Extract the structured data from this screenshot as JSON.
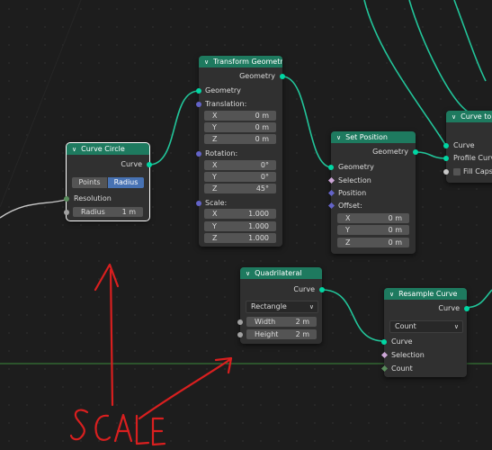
{
  "nodes": {
    "curve_circle": {
      "title": "Curve Circle",
      "output_curve": "Curve",
      "mode_points": "Points",
      "mode_radius": "Radius",
      "resolution": "Resolution",
      "radius_label": "Radius",
      "radius_value": "1 m"
    },
    "transform": {
      "title": "Transform Geometry",
      "output_geometry": "Geometry",
      "input_geometry": "Geometry",
      "translation": "Translation:",
      "tx": "X",
      "tx_val": "0 m",
      "ty": "Y",
      "ty_val": "0 m",
      "tz": "Z",
      "tz_val": "0 m",
      "rotation": "Rotation:",
      "rx": "X",
      "rx_val": "0°",
      "ry": "Y",
      "ry_val": "0°",
      "rz": "Z",
      "rz_val": "45°",
      "scale": "Scale:",
      "sx": "X",
      "sx_val": "1.000",
      "sy": "Y",
      "sy_val": "1.000",
      "sz": "Z",
      "sz_val": "1.000"
    },
    "set_position": {
      "title": "Set Position",
      "output_geometry": "Geometry",
      "input_geometry": "Geometry",
      "selection": "Selection",
      "position": "Position",
      "offset": "Offset:",
      "ox": "X",
      "ox_val": "0 m",
      "oy": "Y",
      "oy_val": "0 m",
      "oz": "Z",
      "oz_val": "0 m"
    },
    "curve_to_mesh": {
      "title": "Curve to M",
      "curve": "Curve",
      "profile": "Profile Curve",
      "fill_caps": "Fill Caps"
    },
    "quadrilateral": {
      "title": "Quadrilateral",
      "output_curve": "Curve",
      "mode": "Rectangle",
      "width_label": "Width",
      "width_value": "2 m",
      "height_label": "Height",
      "height_value": "2 m"
    },
    "resample": {
      "title": "Resample Curve",
      "output_curve": "Curve",
      "mode": "Count",
      "curve": "Curve",
      "selection": "Selection",
      "count": "Count"
    }
  },
  "annotation": {
    "text": "SCALE",
    "color": "#d91f1f"
  },
  "colors": {
    "header": "#1e7a5f",
    "geometry_socket": "#00d6a3",
    "vector_socket": "#6363c7",
    "float_socket": "#a1a1a1",
    "wire": "#22c59a"
  }
}
